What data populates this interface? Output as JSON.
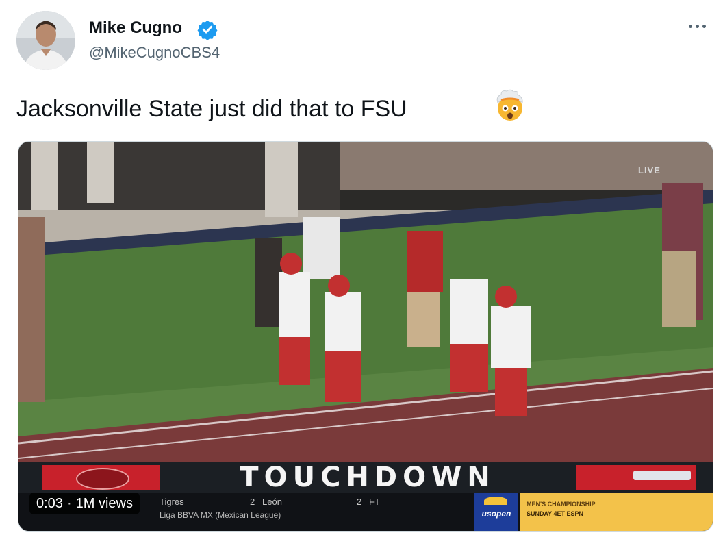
{
  "author": {
    "name": "Mike Cugno",
    "handle": "@MikeCugnoCBS4",
    "verified": true
  },
  "tweet": {
    "text": "Jacksonville State just did that to FSU",
    "emoji": "exploding-head-emoji"
  },
  "media": {
    "type": "video",
    "live_label": "LIVE",
    "banner_text": "TOUCHDOWN",
    "timecode": "0:03",
    "separator": "·",
    "views": "1M views",
    "ticker": {
      "team1": "Tigres",
      "score1": "2",
      "team2": "León",
      "score2": "2",
      "status": "FT",
      "league": "Liga BBVA MX (Mexican League)"
    },
    "sponsor": "usopen",
    "promo_line1": "MEN'S CHAMPIONSHIP",
    "promo_line2": "SUNDAY 4ET ESPN"
  },
  "colors": {
    "verified_blue": "#1d9bf0",
    "touchdown_red": "#c8212b",
    "usopen_blue": "#1d3d9a",
    "promo_yellow": "#f3c24a"
  }
}
